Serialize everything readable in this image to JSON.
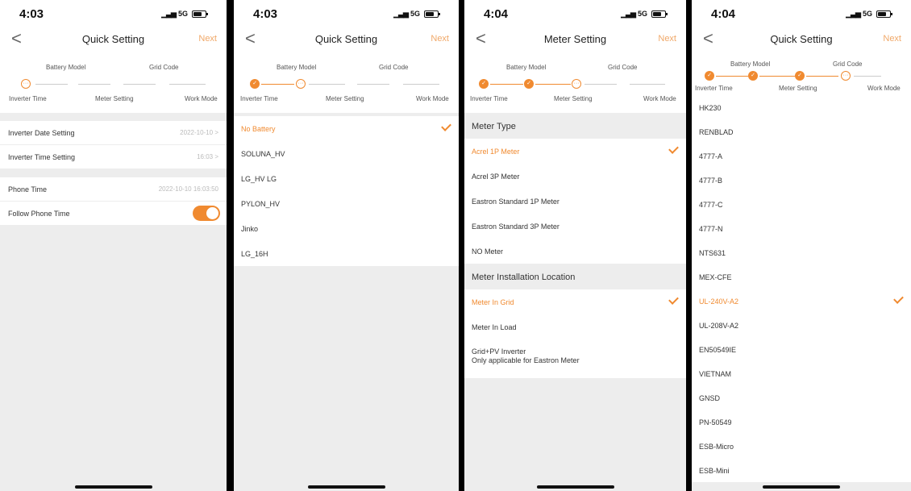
{
  "status": {
    "p1_time": "4:03",
    "p2_time": "4:03",
    "p3_time": "4:04",
    "p4_time": "4:04",
    "network": "5G"
  },
  "nav": {
    "quick_title": "Quick Setting",
    "meter_title": "Meter Setting",
    "next_label": "Next",
    "back_glyph": "<"
  },
  "steps": {
    "battery_model": "Battery Model",
    "grid_code": "Grid Code",
    "inverter_time": "Inverter Time",
    "meter_setting": "Meter Setting",
    "work_mode": "Work Mode",
    "pending_glyph": "···"
  },
  "inverter_time_screen": {
    "date_label": "Inverter Date Setting",
    "date_value": "2022-10-10 >",
    "time_label": "Inverter Time Setting",
    "time_value": "16:03 >",
    "phone_time_label": "Phone Time",
    "phone_time_value": "2022-10-10 16:03:50",
    "follow_label": "Follow Phone Time",
    "follow_on": true
  },
  "battery_screen": {
    "options": [
      "No Battery",
      "SOLUNA_HV",
      "LG_HV LG",
      "PYLON_HV",
      "Jinko",
      "LG_16H"
    ],
    "selected": "No Battery"
  },
  "meter_screen": {
    "type_header": "Meter Type",
    "types": [
      "Acrel 1P Meter",
      "Acrel 3P Meter",
      "Eastron Standard 1P Meter",
      "Eastron Standard 3P Meter",
      "NO Meter"
    ],
    "selected_type": "Acrel 1P Meter",
    "location_header": "Meter Installation Location",
    "locations": [
      "Meter In Grid",
      "Meter In Load"
    ],
    "selected_location": "Meter In Grid",
    "grid_pv_line1": "Grid+PV Inverter",
    "grid_pv_line2": "Only applicable for Eastron Meter"
  },
  "grid_screen": {
    "codes": [
      "HK230",
      "RENBLAD",
      "4777-A",
      "4777-B",
      "4777-C",
      "4777-N",
      "NTS631",
      "MEX-CFE",
      "UL-240V-A2",
      "UL-208V-A2",
      "EN50549IE",
      "VIETNAM",
      "GNSD",
      "PN-50549",
      "ESB-Micro",
      "ESB-Mini"
    ],
    "selected": "UL-240V-A2"
  },
  "colors": {
    "accent": "#f08a30",
    "background": "#ededed"
  }
}
